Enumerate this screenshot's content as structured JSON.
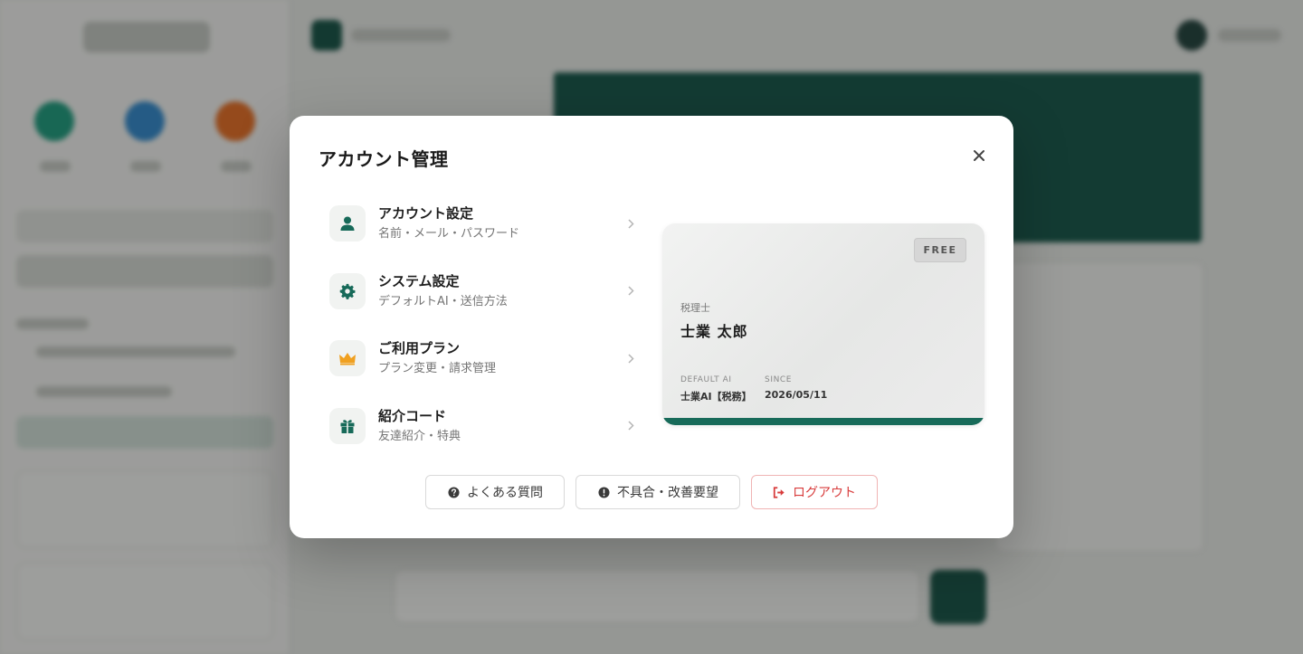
{
  "modal": {
    "title": "アカウント管理"
  },
  "menu": [
    {
      "label": "アカウント設定",
      "sub": "名前・メール・パスワード",
      "icon": "user-icon"
    },
    {
      "label": "システム設定",
      "sub": "デフォルトAI・送信方法",
      "icon": "gear-icon"
    },
    {
      "label": "ご利用プラン",
      "sub": "プラン変更・請求管理",
      "icon": "crown-icon"
    },
    {
      "label": "紹介コード",
      "sub": "友達紹介・特典",
      "icon": "gift-icon"
    }
  ],
  "card": {
    "plan": "FREE",
    "role": "税理士",
    "name": "士業 太郎",
    "default_ai_label": "DEFAULT AI",
    "default_ai_value": "士業AI【税務】",
    "since_label": "SINCE",
    "since_value": "2026/05/11"
  },
  "footer": {
    "faq": "よくある質問",
    "feedback": "不具合・改善要望",
    "logout": "ログアウト"
  },
  "colors": {
    "accent": "#176a59",
    "crown": "#f0a020",
    "danger": "#d83b3b"
  }
}
